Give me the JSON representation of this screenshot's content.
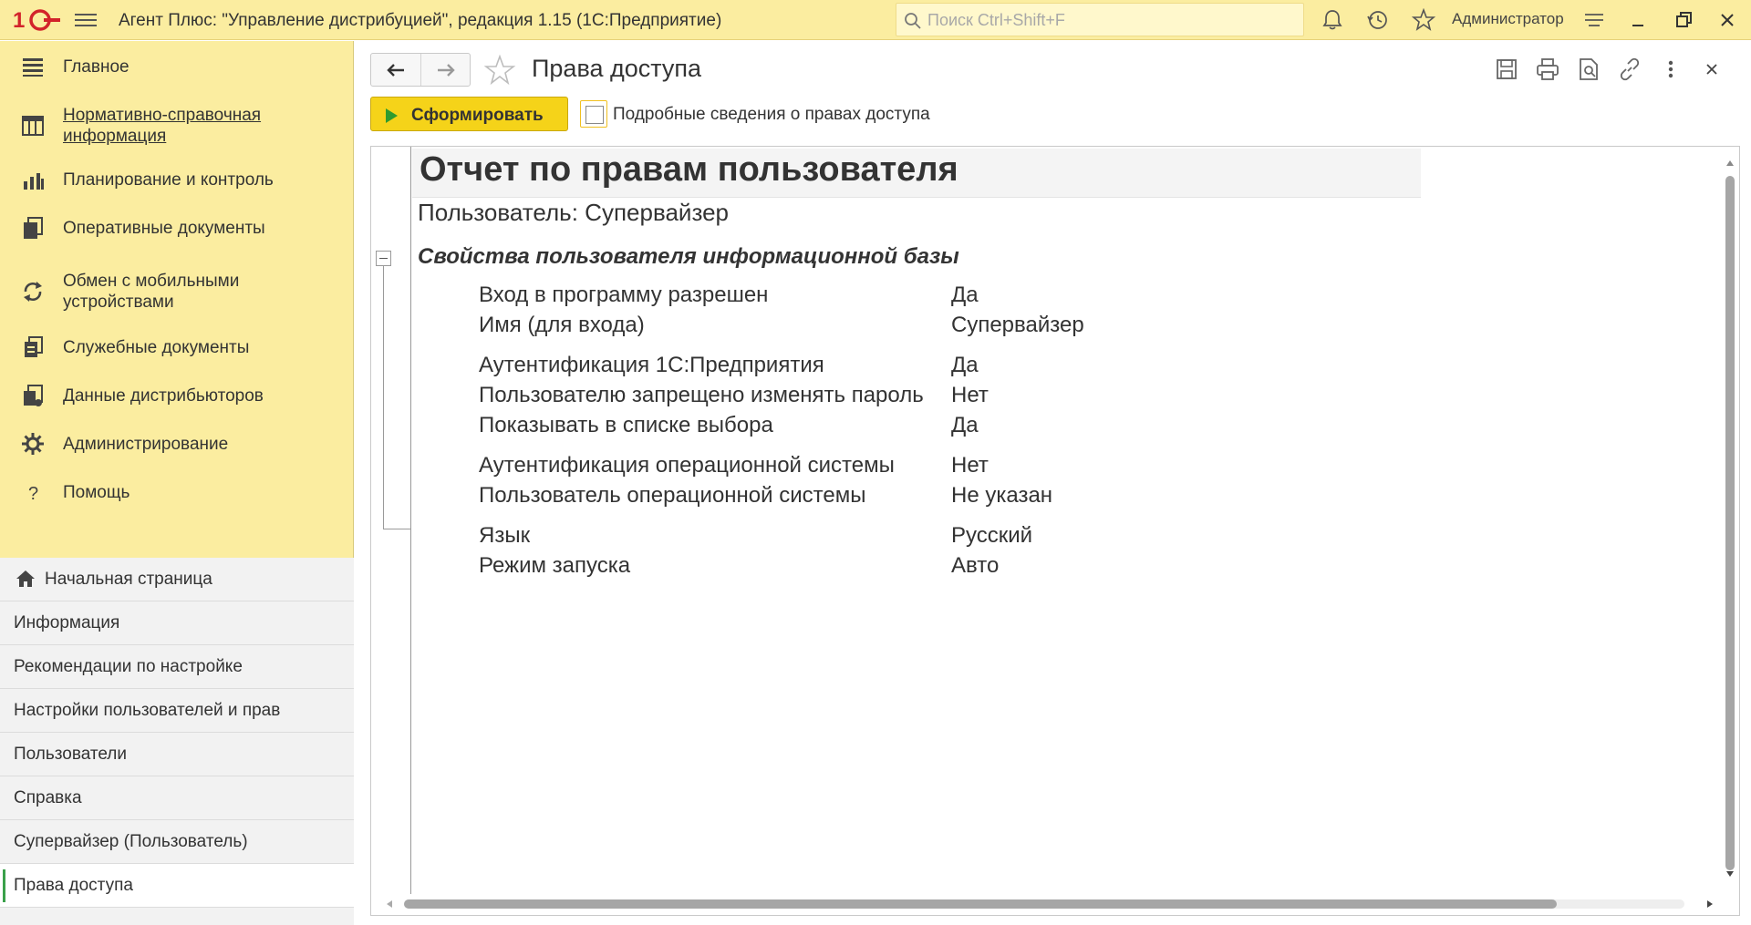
{
  "titlebar": {
    "app_title": "Агент Плюс: \"Управление дистрибуцией\", редакция 1.15  (1С:Предприятие)",
    "search_placeholder": "Поиск Ctrl+Shift+F",
    "user": "Администратор",
    "brand_color": "#fbeda0"
  },
  "sidebar": {
    "sections": [
      {
        "label": "Главное",
        "icon": "list-icon"
      },
      {
        "label": "Нормативно-справочная информация",
        "icon": "catalog-icon"
      },
      {
        "label": "Планирование и контроль",
        "icon": "chart-icon"
      },
      {
        "label": "Оперативные документы",
        "icon": "documents-icon"
      },
      {
        "label": "Обмен с мобильными устройствами",
        "icon": "sync-icon"
      },
      {
        "label": "Служебные документы",
        "icon": "service-docs-icon"
      },
      {
        "label": "Данные дистрибьюторов",
        "icon": "distributor-data-icon"
      },
      {
        "label": "Администрирование",
        "icon": "gear-icon"
      },
      {
        "label": "Помощь",
        "icon": "question-icon"
      }
    ],
    "open_windows": [
      {
        "label": "Начальная страница"
      },
      {
        "label": "Информация"
      },
      {
        "label": "Рекомендации по настройке"
      },
      {
        "label": "Настройки пользователей и прав"
      },
      {
        "label": "Пользователи"
      },
      {
        "label": "Справка"
      },
      {
        "label": "Супервайзер (Пользователь)"
      },
      {
        "label": "Права доступа"
      }
    ]
  },
  "form": {
    "title": "Права доступа",
    "run_button": "Сформировать",
    "detailed_checkbox_label": "Подробные сведения о правах доступа",
    "detailed_checked": false
  },
  "report": {
    "title": "Отчет по правам пользователя",
    "user_line": "Пользователь: Супервайзер",
    "section_title": "Свойства пользователя информационной базы",
    "properties": [
      {
        "name": "Вход в программу разрешен",
        "value": "Да"
      },
      {
        "name": "Имя (для входа)",
        "value": "Супервайзер"
      },
      {
        "name": "Аутентификация 1С:Предприятия",
        "value": "Да"
      },
      {
        "name": "Пользователю запрещено изменять пароль",
        "value": "Нет"
      },
      {
        "name": "Показывать в списке выбора",
        "value": "Да"
      },
      {
        "name": "Аутентификация операционной системы",
        "value": "Нет"
      },
      {
        "name": "Пользователь операционной системы",
        "value": "Не указан"
      },
      {
        "name": "Язык",
        "value": "Русский"
      },
      {
        "name": "Режим запуска",
        "value": "Авто"
      }
    ]
  }
}
